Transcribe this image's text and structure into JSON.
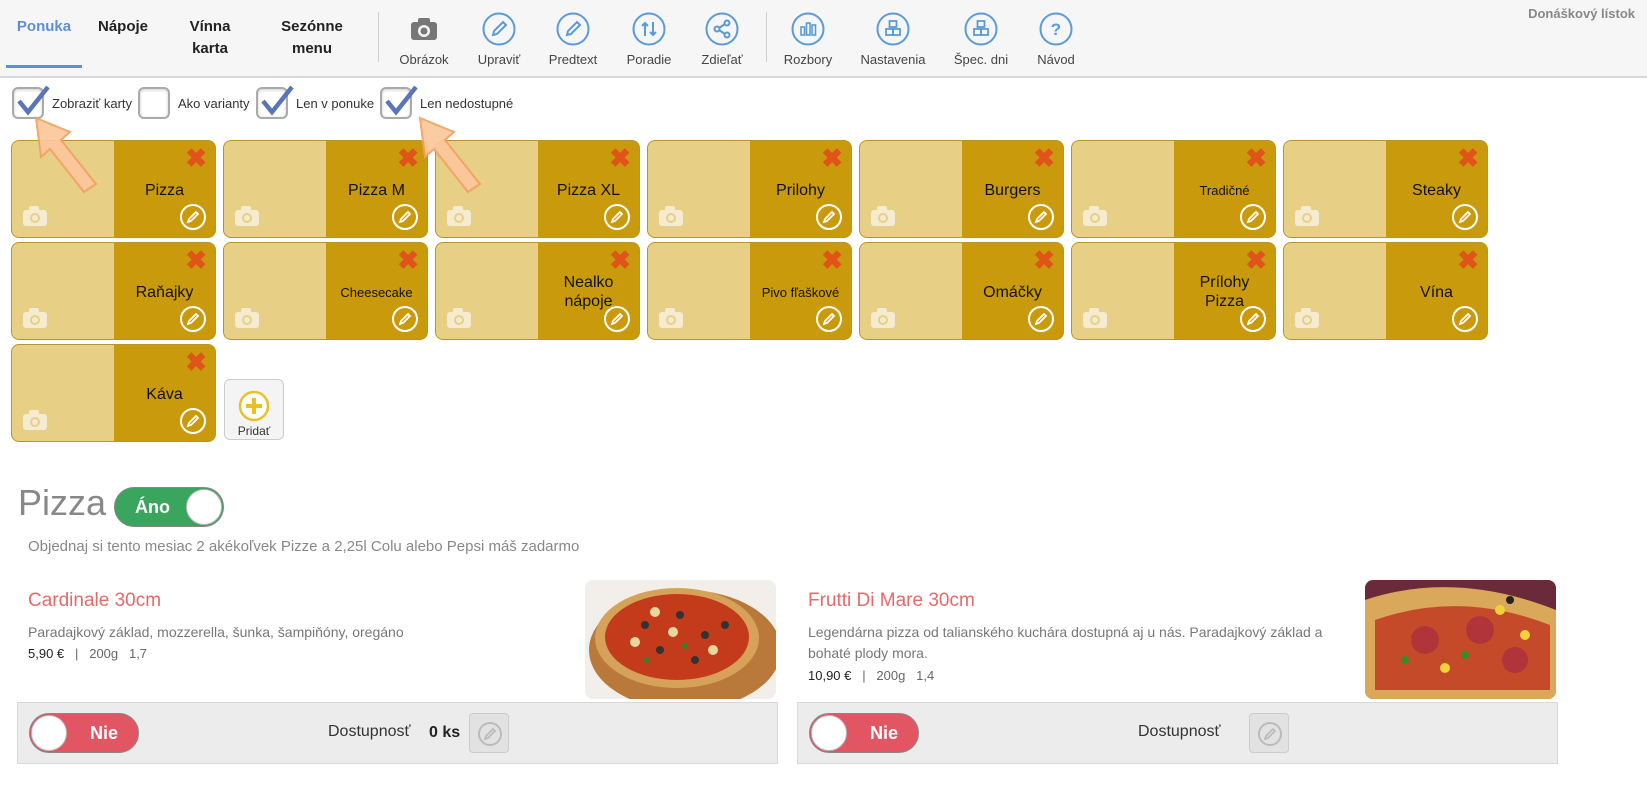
{
  "brand": "Donáškový lístok",
  "nav": {
    "tabs": [
      {
        "l1": "Ponuka",
        "l2": ""
      },
      {
        "l1": "Nápoje",
        "l2": ""
      },
      {
        "l1": "Vínna",
        "l2": "karta"
      },
      {
        "l1": "Sezónne",
        "l2": "menu"
      }
    ],
    "tools": [
      {
        "label": "Obrázok",
        "icon": "camera-icon"
      },
      {
        "label": "Upraviť",
        "icon": "pencil-icon"
      },
      {
        "label": "Predtext",
        "icon": "pencil-icon"
      },
      {
        "label": "Poradie",
        "icon": "reorder-icon"
      },
      {
        "label": "Zdieľať",
        "icon": "share-icon"
      },
      {
        "label": "Rozbory",
        "icon": "chart-icon"
      },
      {
        "label": "Nastavenia",
        "icon": "blocks-icon"
      },
      {
        "label": "Špec. dni",
        "icon": "blocks-icon"
      },
      {
        "label": "Návod",
        "icon": "help-icon"
      }
    ]
  },
  "options": [
    {
      "label": "Zobraziť karty",
      "checked": true
    },
    {
      "label": "Ako varianty",
      "checked": false
    },
    {
      "label": "Len v ponuke",
      "checked": true
    },
    {
      "label": "Len nedostupné",
      "checked": true
    }
  ],
  "categories": [
    "Pizza",
    "Pizza M",
    "Pizza XL",
    "Prilohy",
    "Burgers",
    "Tradičné",
    "Steaky",
    "Raňajky",
    "Cheesecake",
    "Nealko nápoje",
    "Pivo fľaškové",
    "Omáčky",
    "Prílohy Pizza",
    "Vína",
    "Káva"
  ],
  "add_label": "Pridať",
  "section": {
    "title": "Pizza",
    "toggle_label": "Áno",
    "promo": "Objednaj si tento mesiac 2 akékoľvek Pizze a 2,25l Colu alebo Pepsi máš zadarmo"
  },
  "items": [
    {
      "title": "Cardinale 30cm",
      "desc": "Paradajkový základ, mozzerella, šunka, šampiňóny, oregáno",
      "price": "5,90 €",
      "meta": "|   200g   1,7",
      "toggle_label": "Nie",
      "availability_label": "Dostupnosť",
      "qty": "0 ks"
    },
    {
      "title": "Frutti Di Mare 30cm",
      "desc": "Legendárna pizza od talianského kuchára dostupná aj u nás. Paradajkový základ a bohaté plody mora.",
      "price": "10,90 €",
      "meta": "|   200g   1,4",
      "toggle_label": "Nie",
      "availability_label": "Dostupnosť",
      "qty": ""
    }
  ],
  "colors": {
    "accent": "#5b8fd6",
    "card_dark": "#c99a0b",
    "card_light": "#e8cf86",
    "delete": "#e0541a",
    "toggle_on": "#3aa55d",
    "toggle_off": "#e25563",
    "item_title": "#e46a6a"
  }
}
